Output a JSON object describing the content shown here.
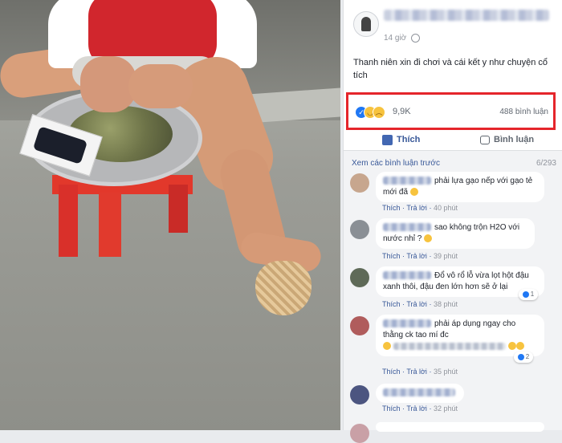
{
  "post": {
    "time": "14 giờ",
    "caption": "Thanh niên xin đi chơi và cái kết y như chuyện cổ tích"
  },
  "reactions": {
    "count": "9,9K",
    "comments_label": "488 bình luận"
  },
  "actions": {
    "like_label": "Thích",
    "comment_label": "Bình luận"
  },
  "comments_header": {
    "previous_label": "Xem các bình luận trước",
    "pager": "6/293"
  },
  "comments": [
    {
      "text": "phải lựa gạo nếp với gạo tẻ mới đã",
      "like": "Thích",
      "reply": "Trả lời",
      "time": "40 phút"
    },
    {
      "text": "sao không trộn H2O với nước nhỉ ?",
      "like": "Thích",
      "reply": "Trả lời",
      "time": "39 phút"
    },
    {
      "text": "Đổ vô rổ lỗ vừa lọt hột đậu xanh thôi, đậu đen lớn hơn sẽ ở lại",
      "like": "Thích",
      "reply": "Trả lời",
      "time": "38 phút",
      "reactions": "1"
    },
    {
      "text": "phải áp dụng ngay cho thằng ck tao mí đc",
      "like": "Thích",
      "reply": "Trả lời",
      "time": "35 phút",
      "reactions": "2"
    },
    {
      "text": "",
      "like": "Thích",
      "reply": "Trả lời",
      "time": "32 phút"
    }
  ]
}
